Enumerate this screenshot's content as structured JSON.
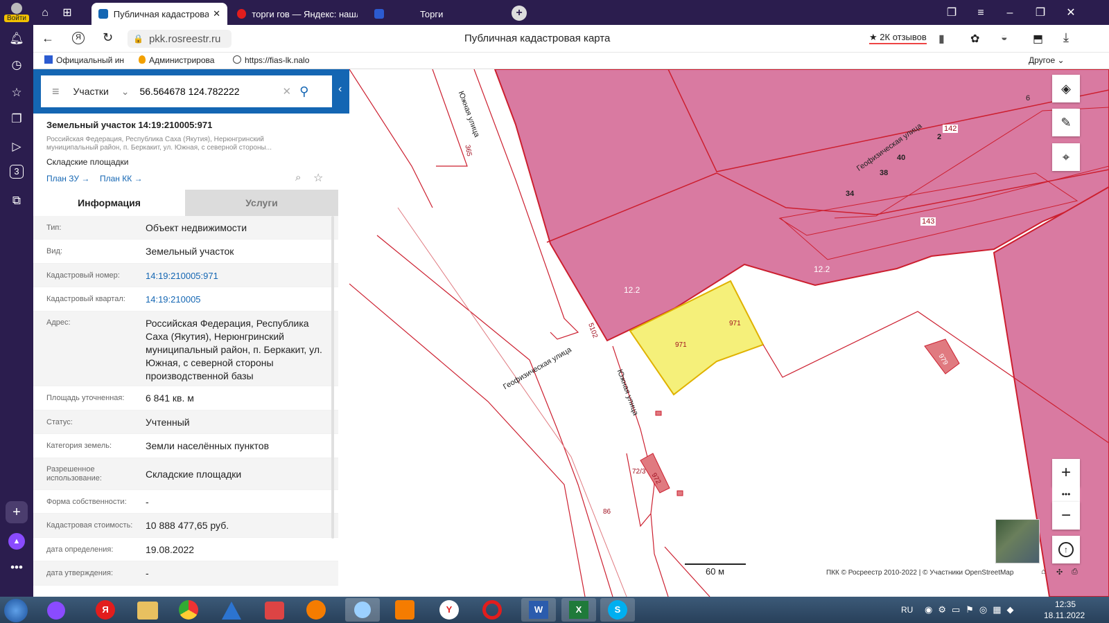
{
  "browser": {
    "login_label": "Войти",
    "tabs": [
      {
        "title": "Публичная кадастрова"
      },
      {
        "title": "торги гов — Яндекс: нашл"
      },
      {
        "title": "Торги"
      }
    ],
    "url": "pkk.rosreestr.ru",
    "page_title": "Публичная кадастровая карта",
    "reviews": "2К отзывов",
    "bookmarks": [
      "Официальный ин",
      "Администрирова",
      "https://fias-lk.nalo"
    ],
    "bookmarks_other": "Другое",
    "sidebar_badge": "3"
  },
  "search": {
    "type_label": "Участки",
    "value": "56.564678 124.782222"
  },
  "parcel": {
    "title": "Земельный участок 14:19:210005:971",
    "address_short": "Российская Федерация, Республика Саха (Якутия), Нерюнгринский муниципальный район, п. Беркакит, ул. Южная, с северной стороны...",
    "usage_short": "Складские площадки",
    "link_plan_zu": "План ЗУ →",
    "link_plan_kk": "План КК →"
  },
  "tabs": {
    "info": "Информация",
    "services": "Услуги"
  },
  "details": [
    {
      "label": "Тип:",
      "value": "Объект недвижимости"
    },
    {
      "label": "Вид:",
      "value": "Земельный участок"
    },
    {
      "label": "Кадастровый номер:",
      "value": "14:19:210005:971"
    },
    {
      "label": "Кадастровый квартал:",
      "value": "14:19:210005"
    },
    {
      "label": "Адрес:",
      "value_lines": [
        "Российская Федерация, Республика",
        "Саха (Якутия), Нерюнгринский",
        "муниципальный район, п. Беркакит, ул.",
        "Южная, с северной стороны",
        "производственной базы"
      ]
    },
    {
      "label": "Площадь уточненная:",
      "value": "6 841 кв. м"
    },
    {
      "label": "Статус:",
      "value": "Учтенный"
    },
    {
      "label": "Категория земель:",
      "value": "Земли населённых пунктов"
    },
    {
      "label_lines": [
        "Разрешенное",
        "использование:"
      ],
      "value": "Складские площадки"
    },
    {
      "label": "Форма собственности:",
      "value": "-"
    },
    {
      "label": "Кадастровая стоимость:",
      "value": "10 888 477,65 руб."
    },
    {
      "label": "дата определения:",
      "value": "19.08.2022"
    },
    {
      "label": "дата утверждения:",
      "value": "-"
    }
  ],
  "map": {
    "labels": {
      "street_south_top": "Южная улица",
      "street_geo_top": "Геофизическая улица",
      "street_geo_bottom": "Геофизическая улица",
      "street_south_bottom": "Южная улица",
      "n365": "365",
      "n6": "6",
      "n142": "142",
      "n2": "2",
      "n40": "40",
      "n38": "38",
      "n34": "34",
      "n143": "143",
      "n12_2a": "12.2",
      "n12_2b": "12.2",
      "n971a": "971",
      "n971b": "971",
      "n979": "979",
      "n72_3": "72/3",
      "n972": "972",
      "n86": "86",
      "n5102": "5102"
    },
    "scale_label": "60 м",
    "copyright": "ПКК © Росреестр 2010-2022 | © Участники OpenStreetMap"
  },
  "taskbar": {
    "lang": "RU",
    "time": "12:35",
    "date": "18.11.2022"
  },
  "colors": {
    "chrome": "#2b1d4e",
    "accent": "#1466b3",
    "parcel_fill": "#d97aa1",
    "parcel_stroke": "#cc1f2f",
    "selected_fill": "#f5f07a"
  }
}
